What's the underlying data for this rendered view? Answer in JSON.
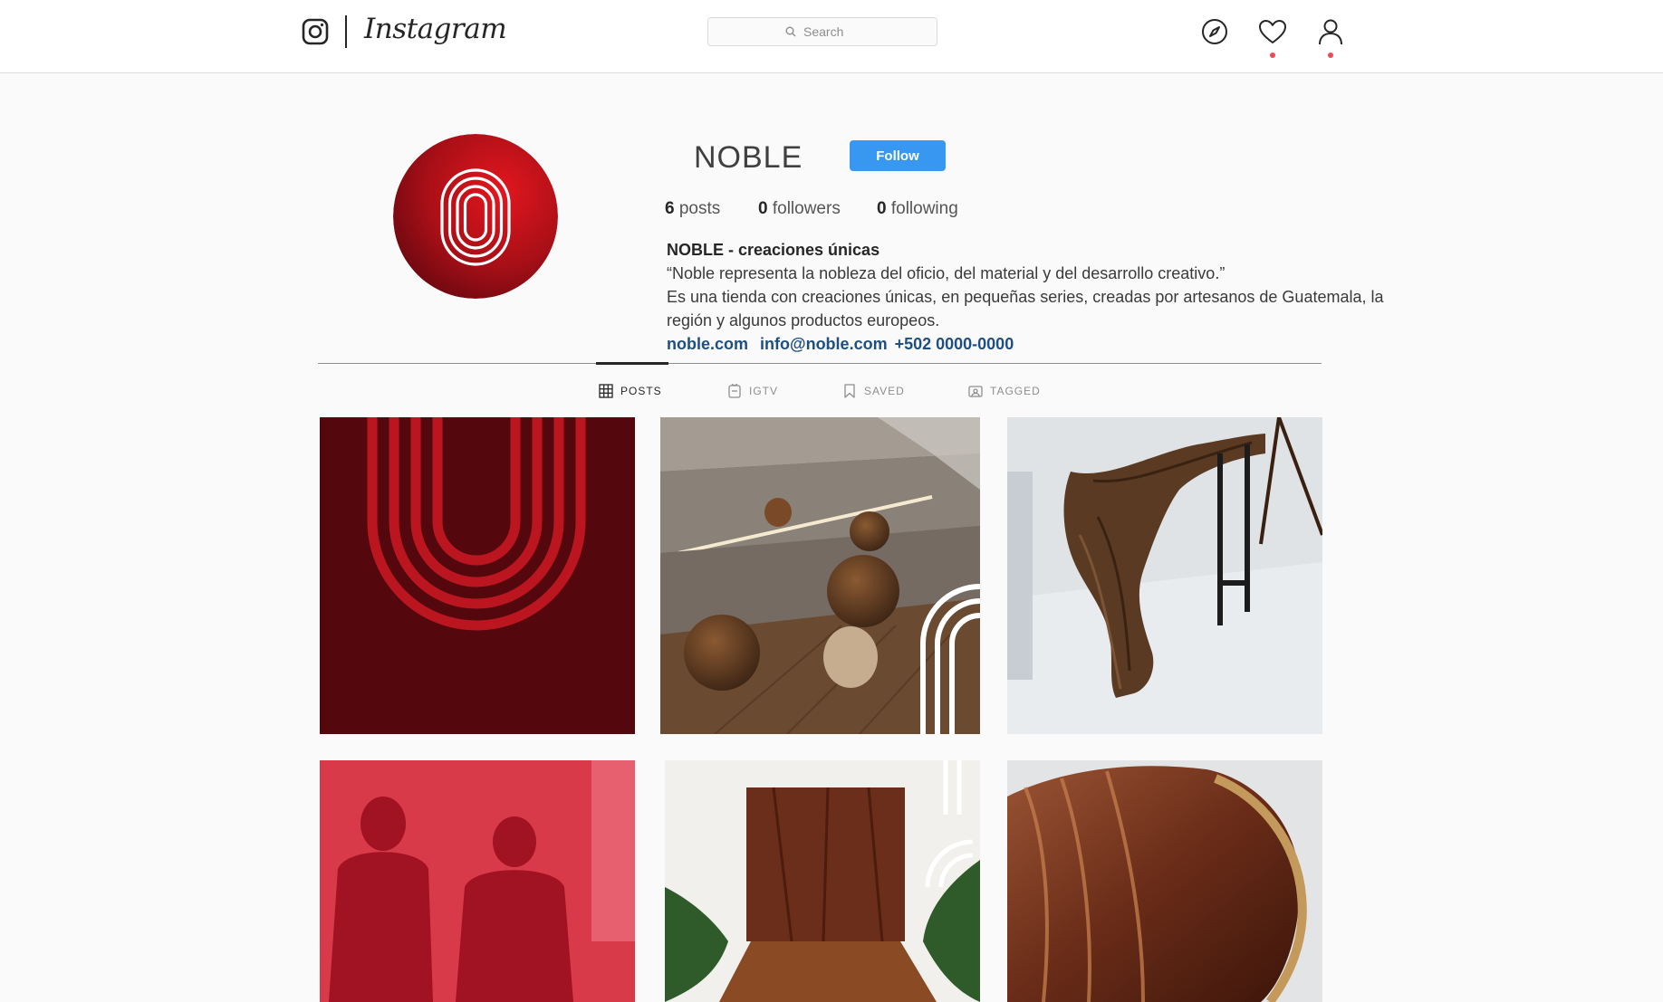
{
  "header": {
    "logo_word": "Instagram",
    "search": {
      "placeholder": "Search"
    },
    "icons": [
      "instagram-glyph-icon",
      "compass-icon",
      "heart-icon",
      "user-icon"
    ],
    "accent_color": "#3897f0",
    "notification_dot_color": "#ed4956"
  },
  "profile": {
    "username": "NOBLE",
    "follow_label": "Follow",
    "stats": {
      "posts_count": "6",
      "posts_label": "posts",
      "followers_count": "0",
      "followers_label": "followers",
      "following_count": "0",
      "following_label": "following"
    },
    "bio": {
      "name": "NOBLE - creaciones únicas",
      "line1": "“Noble representa la nobleza del oficio, del material y del desarrollo creativo.”",
      "line2": "Es una tienda con creaciones únicas, en pequeñas series, creadas por artesanos de Guatemala, la región y algunos productos europeos.",
      "website": "noble.com",
      "email": "info@noble.com",
      "phone": "+502 0000-0000"
    }
  },
  "tabs": [
    {
      "label": "POSTS",
      "icon": "grid-icon",
      "active": true
    },
    {
      "label": "IGTV",
      "icon": "igtv-icon",
      "active": false
    },
    {
      "label": "SAVED",
      "icon": "bookmark-icon",
      "active": false
    },
    {
      "label": "TAGGED",
      "icon": "tagged-icon",
      "active": false
    }
  ],
  "posts": [
    {
      "subject": "red logo pattern"
    },
    {
      "subject": "wooden spheres on stairs"
    },
    {
      "subject": "curved wooden console table"
    },
    {
      "subject": "two people red overlay"
    },
    {
      "subject": "wooden entrance door"
    },
    {
      "subject": "wood slab detail"
    }
  ]
}
